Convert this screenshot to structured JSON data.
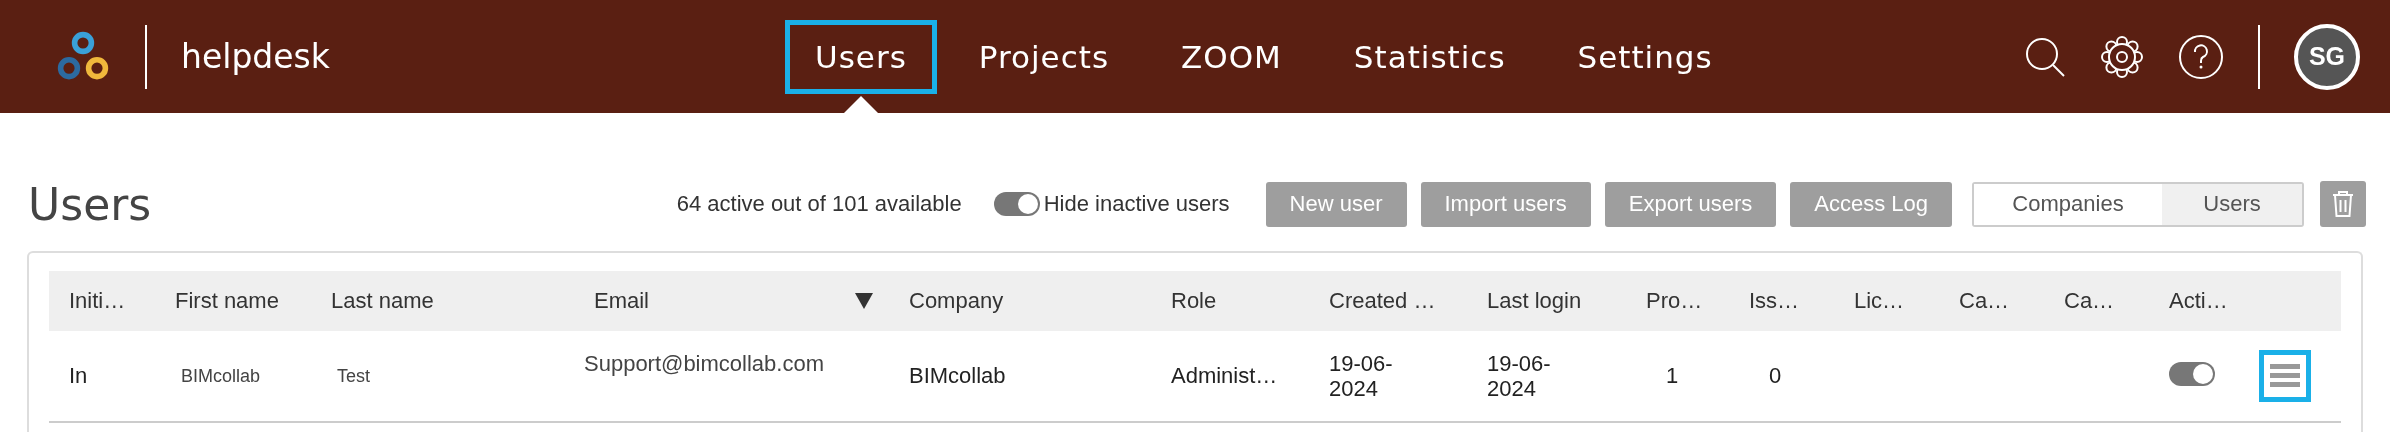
{
  "header": {
    "app_name": "helpdesk",
    "nav": [
      {
        "label": "Users",
        "selected": true,
        "highlighted": true
      },
      {
        "label": "Projects",
        "selected": false,
        "highlighted": false
      },
      {
        "label": "ZOOM",
        "selected": false,
        "highlighted": false
      },
      {
        "label": "Statistics",
        "selected": false,
        "highlighted": false
      },
      {
        "label": "Settings",
        "selected": false,
        "highlighted": false
      }
    ],
    "avatar": "SG"
  },
  "page": {
    "title": "Users",
    "summary": "64 active out of 101 available",
    "hide_inactive": {
      "label": "Hide inactive users",
      "on": true
    },
    "buttons": [
      "New user",
      "Import users",
      "Export users",
      "Access Log"
    ],
    "view_switch": [
      {
        "label": "Companies",
        "selected": false
      },
      {
        "label": "Users",
        "selected": true
      }
    ]
  },
  "table": {
    "columns": [
      {
        "label": "Initi…",
        "sorted": false
      },
      {
        "label": "First name",
        "sorted": false
      },
      {
        "label": "Last name",
        "sorted": false
      },
      {
        "label": "Email",
        "sorted": true
      },
      {
        "label": "Company",
        "sorted": false
      },
      {
        "label": "Role",
        "sorted": false
      },
      {
        "label": "Created …",
        "sorted": false
      },
      {
        "label": "Last login",
        "sorted": false
      },
      {
        "label": "Pro…",
        "sorted": false
      },
      {
        "label": "Iss…",
        "sorted": false
      },
      {
        "label": "Lic…",
        "sorted": false
      },
      {
        "label": "Ca…",
        "sorted": false
      },
      {
        "label": "Ca…",
        "sorted": false
      },
      {
        "label": "Acti…",
        "sorted": false
      }
    ],
    "rows": [
      {
        "cells": [
          "In",
          "BIMcollab",
          "Test",
          "Support@bimcollab.com",
          "BIMcollab",
          "Administ…",
          "19-06-2024",
          "19-06-2024",
          "1",
          "0",
          "",
          "",
          "",
          ""
        ],
        "active": true,
        "menu_highlighted": true
      }
    ]
  }
}
